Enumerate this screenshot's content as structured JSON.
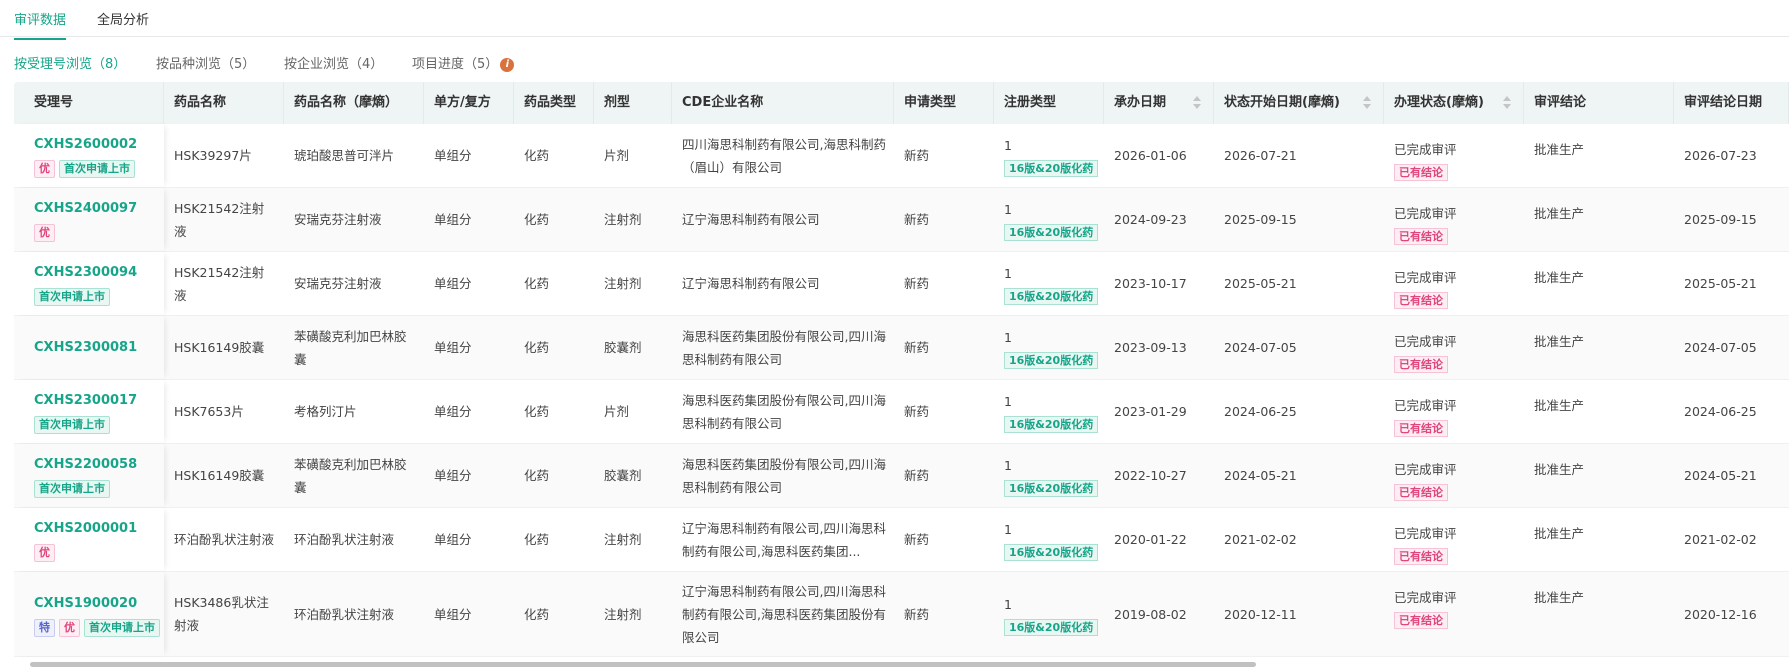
{
  "nav": {
    "tabs": [
      {
        "label": "审评数据",
        "active": true
      },
      {
        "label": "全局分析",
        "active": false
      }
    ]
  },
  "subtabs": [
    {
      "label": "按受理号浏览（8）",
      "active": true
    },
    {
      "label": "按品种浏览（5）",
      "active": false
    },
    {
      "label": "按企业浏览（4）",
      "active": false
    },
    {
      "label": "项目进度（5）",
      "active": false,
      "icon": "info-icon"
    }
  ],
  "columns": [
    "受理号",
    "药品名称",
    "药品名称（摩熵）",
    "单方/复方",
    "药品类型",
    "剂型",
    "CDE企业名称",
    "申请类型",
    "注册类型",
    "承办日期",
    "状态开始日期(摩熵)",
    "办理状态(摩熵)",
    "审评结论",
    "审评结论日期"
  ],
  "colors": {
    "accent": "#17a589",
    "tag_pink": "#e0457b",
    "tag_purple": "#5a64c8"
  },
  "rows": [
    {
      "id": "CXHS2600002",
      "tags": [
        "优",
        "首次申请上市"
      ],
      "name": "HSK39297片",
      "name_ms": "琥珀酸思普可泮片",
      "compound": "单组分",
      "drug_type": "化药",
      "form": "片剂",
      "company": "四川海思科制药有限公司,海思科制药（眉山）有限公司",
      "app_type": "新药",
      "reg_type": "1",
      "reg_tag": "16版&20版化药",
      "accept_date": "2026-01-06",
      "status_date": "2026-07-21",
      "status": "已完成审评",
      "status_tag": "已有结论",
      "conclusion": "批准生产",
      "conclusion_date": "2026-07-23"
    },
    {
      "id": "CXHS2400097",
      "tags": [
        "优"
      ],
      "name": "HSK21542注射液",
      "name_ms": "安瑞克芬注射液",
      "compound": "单组分",
      "drug_type": "化药",
      "form": "注射剂",
      "company": "辽宁海思科制药有限公司",
      "app_type": "新药",
      "reg_type": "1",
      "reg_tag": "16版&20版化药",
      "accept_date": "2024-09-23",
      "status_date": "2025-09-15",
      "status": "已完成审评",
      "status_tag": "已有结论",
      "conclusion": "批准生产",
      "conclusion_date": "2025-09-15"
    },
    {
      "id": "CXHS2300094",
      "tags": [
        "首次申请上市"
      ],
      "name": "HSK21542注射液",
      "name_ms": "安瑞克芬注射液",
      "compound": "单组分",
      "drug_type": "化药",
      "form": "注射剂",
      "company": "辽宁海思科制药有限公司",
      "app_type": "新药",
      "reg_type": "1",
      "reg_tag": "16版&20版化药",
      "accept_date": "2023-10-17",
      "status_date": "2025-05-21",
      "status": "已完成审评",
      "status_tag": "已有结论",
      "conclusion": "批准生产",
      "conclusion_date": "2025-05-21"
    },
    {
      "id": "CXHS2300081",
      "tags": [],
      "name": "HSK16149胶囊",
      "name_ms": "苯磺酸克利加巴林胶囊",
      "compound": "单组分",
      "drug_type": "化药",
      "form": "胶囊剂",
      "company": "海思科医药集团股份有限公司,四川海思科制药有限公司",
      "app_type": "新药",
      "reg_type": "1",
      "reg_tag": "16版&20版化药",
      "accept_date": "2023-09-13",
      "status_date": "2024-07-05",
      "status": "已完成审评",
      "status_tag": "已有结论",
      "conclusion": "批准生产",
      "conclusion_date": "2024-07-05"
    },
    {
      "id": "CXHS2300017",
      "tags": [
        "首次申请上市"
      ],
      "name": "HSK7653片",
      "name_ms": "考格列汀片",
      "compound": "单组分",
      "drug_type": "化药",
      "form": "片剂",
      "company": "海思科医药集团股份有限公司,四川海思科制药有限公司",
      "app_type": "新药",
      "reg_type": "1",
      "reg_tag": "16版&20版化药",
      "accept_date": "2023-01-29",
      "status_date": "2024-06-25",
      "status": "已完成审评",
      "status_tag": "已有结论",
      "conclusion": "批准生产",
      "conclusion_date": "2024-06-25"
    },
    {
      "id": "CXHS2200058",
      "tags": [
        "首次申请上市"
      ],
      "name": "HSK16149胶囊",
      "name_ms": "苯磺酸克利加巴林胶囊",
      "compound": "单组分",
      "drug_type": "化药",
      "form": "胶囊剂",
      "company": "海思科医药集团股份有限公司,四川海思科制药有限公司",
      "app_type": "新药",
      "reg_type": "1",
      "reg_tag": "16版&20版化药",
      "accept_date": "2022-10-27",
      "status_date": "2024-05-21",
      "status": "已完成审评",
      "status_tag": "已有结论",
      "conclusion": "批准生产",
      "conclusion_date": "2024-05-21"
    },
    {
      "id": "CXHS2000001",
      "tags": [
        "优"
      ],
      "name": "环泊酚乳状注射液",
      "name_ms": "环泊酚乳状注射液",
      "compound": "单组分",
      "drug_type": "化药",
      "form": "注射剂",
      "company": "辽宁海思科制药有限公司,四川海思科制药有限公司,海思科医药集团...",
      "app_type": "新药",
      "reg_type": "1",
      "reg_tag": "16版&20版化药",
      "accept_date": "2020-01-22",
      "status_date": "2021-02-02",
      "status": "已完成审评",
      "status_tag": "已有结论",
      "conclusion": "批准生产",
      "conclusion_date": "2021-02-02"
    },
    {
      "id": "CXHS1900020",
      "tags": [
        "特",
        "优",
        "首次申请上市"
      ],
      "name": "HSK3486乳状注射液",
      "name_ms": "环泊酚乳状注射液",
      "compound": "单组分",
      "drug_type": "化药",
      "form": "注射剂",
      "company": "辽宁海思科制药有限公司,四川海思科制药有限公司,海思科医药集团股份有限公司",
      "app_type": "新药",
      "reg_type": "1",
      "reg_tag": "16版&20版化药",
      "accept_date": "2019-08-02",
      "status_date": "2020-12-11",
      "status": "已完成审评",
      "status_tag": "已有结论",
      "conclusion": "批准生产",
      "conclusion_date": "2020-12-16"
    }
  ]
}
